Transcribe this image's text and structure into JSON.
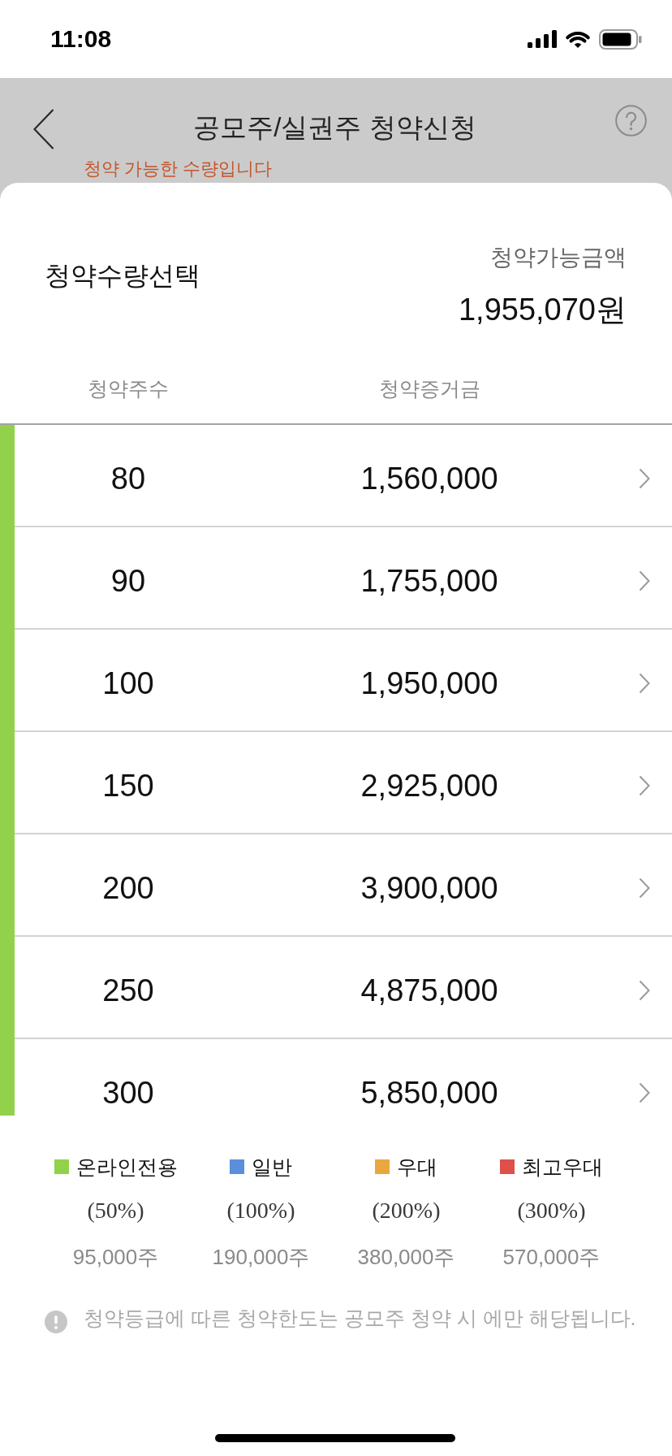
{
  "status_bar": {
    "time": "11:08"
  },
  "header": {
    "title": "공모주/실권주 청약신청"
  },
  "notice": "청약 가능한 수량입니다",
  "sheet": {
    "title": "청약수량선택",
    "available_label": "청약가능금액",
    "available_amount": "1,955,070원"
  },
  "table": {
    "columns": [
      "청약주수",
      "청약증거금"
    ],
    "rows": [
      {
        "shares": "80",
        "deposit": "1,560,000",
        "color": "#92d14a"
      },
      {
        "shares": "90",
        "deposit": "1,755,000",
        "color": "#92d14a"
      },
      {
        "shares": "100",
        "deposit": "1,950,000",
        "color": "#92d14a"
      },
      {
        "shares": "150",
        "deposit": "2,925,000",
        "color": "#92d14a"
      },
      {
        "shares": "200",
        "deposit": "3,900,000",
        "color": "#92d14a"
      },
      {
        "shares": "250",
        "deposit": "4,875,000",
        "color": "#92d14a"
      },
      {
        "shares": "300",
        "deposit": "5,850,000",
        "color": "#92d14a"
      }
    ]
  },
  "legend": [
    {
      "label": "온라인전용",
      "color": "#92d14a",
      "rate": "(50%)",
      "limit": "95,000주"
    },
    {
      "label": "일반",
      "color": "#5b8fdc",
      "rate": "(100%)",
      "limit": "190,000주"
    },
    {
      "label": "우대",
      "color": "#e9a83f",
      "rate": "(200%)",
      "limit": "380,000주"
    },
    {
      "label": "최고우대",
      "color": "#e0504a",
      "rate": "(300%)",
      "limit": "570,000주"
    }
  ],
  "note": "청약등급에 따른 청약한도는 공모주 청약 시 에만 해당됩니다."
}
